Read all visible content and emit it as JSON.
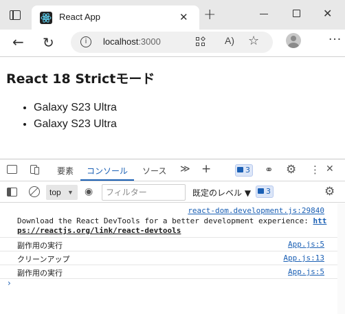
{
  "browser": {
    "tab_title": "React App",
    "close_tab_glyph": "✕",
    "new_tab_glyph": "+",
    "url_host": "localhost",
    "url_port": ":3000",
    "info_glyph": "i",
    "read_aloud_glyph": "A)",
    "favorite_glyph": "☆",
    "more_glyph": "···",
    "back_glyph": "←",
    "reload_glyph": "↻",
    "close_window_glyph": "✕"
  },
  "page": {
    "heading": "React 18 Strictモード",
    "items": [
      "Galaxy S23 Ultra",
      "Galaxy S23 Ultra"
    ]
  },
  "devtools": {
    "tabs": [
      "要素",
      "コンソール",
      "ソース"
    ],
    "more_tabs_glyph": "≫",
    "add_tab_glyph": "+",
    "issue_count": "3",
    "more_glyph": "⋮",
    "close_glyph": "✕",
    "context": "top",
    "caret": "▼",
    "filter_placeholder": "フィルター",
    "level_label": "既定のレベル ▼",
    "level_issue_count": "3",
    "eye_glyph": "◉",
    "messages": [
      {
        "source": "react-dom.development.js:29840",
        "line1": "Download the React DevTools for a better development experience: ",
        "link_part1": "htt",
        "link_part2": "ps://reactjs.org/link/react-devtools"
      },
      {
        "text": "副作用の実行",
        "source": "App.js:5"
      },
      {
        "text": "クリーンアップ",
        "source": "App.js:13"
      },
      {
        "text": "副作用の実行",
        "source": "App.js:5"
      }
    ],
    "prompt_glyph": "›"
  }
}
